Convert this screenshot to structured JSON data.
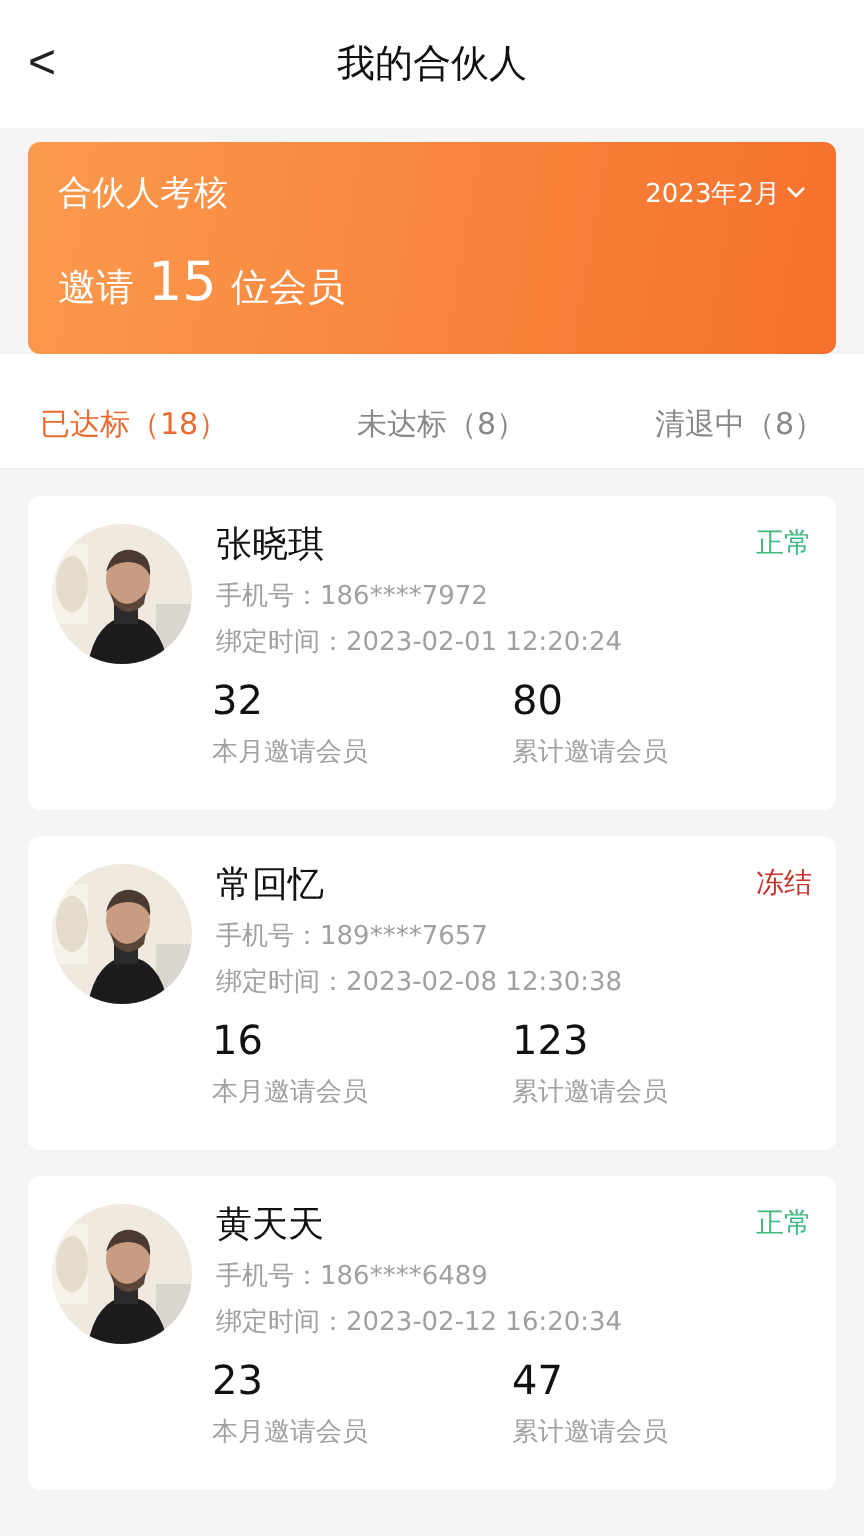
{
  "header": {
    "back": "<",
    "title": "我的合伙人"
  },
  "banner": {
    "title": "合伙人考核",
    "month": "2023年2月",
    "invite_prefix": "邀请",
    "invite_count": "15",
    "invite_suffix": "位会员"
  },
  "tabs": [
    {
      "label": "已达标（18）",
      "selected": true
    },
    {
      "label": "未达标（8）",
      "selected": false
    },
    {
      "label": "清退中（8）",
      "selected": false
    }
  ],
  "partners": [
    {
      "name": "张晓琪",
      "status": "正常",
      "color": "#3dba7d",
      "phone": "手机号：186****7972",
      "bound": "绑定时间：2023-02-01 12:20:24",
      "stats": [
        {
          "value": "32",
          "label": "本月邀请会员"
        },
        {
          "value": "80",
          "label": "累计邀请会员"
        }
      ]
    },
    {
      "name": "常回忆",
      "status": "冻结",
      "color": "#c8332b",
      "phone": "手机号：189****7657",
      "bound": "绑定时间：2023-02-08 12:30:38",
      "stats": [
        {
          "value": "16",
          "label": "本月邀请会员"
        },
        {
          "value": "123",
          "label": "累计邀请会员"
        }
      ]
    },
    {
      "name": "黄天天",
      "status": "正常",
      "color": "#3dba7d",
      "phone": "手机号：186****6489",
      "bound": "绑定时间：2023-02-12 16:20:34",
      "stats": [
        {
          "value": "23",
          "label": "本月邀请会员"
        },
        {
          "value": "47",
          "label": "累计邀请会员"
        }
      ]
    }
  ]
}
